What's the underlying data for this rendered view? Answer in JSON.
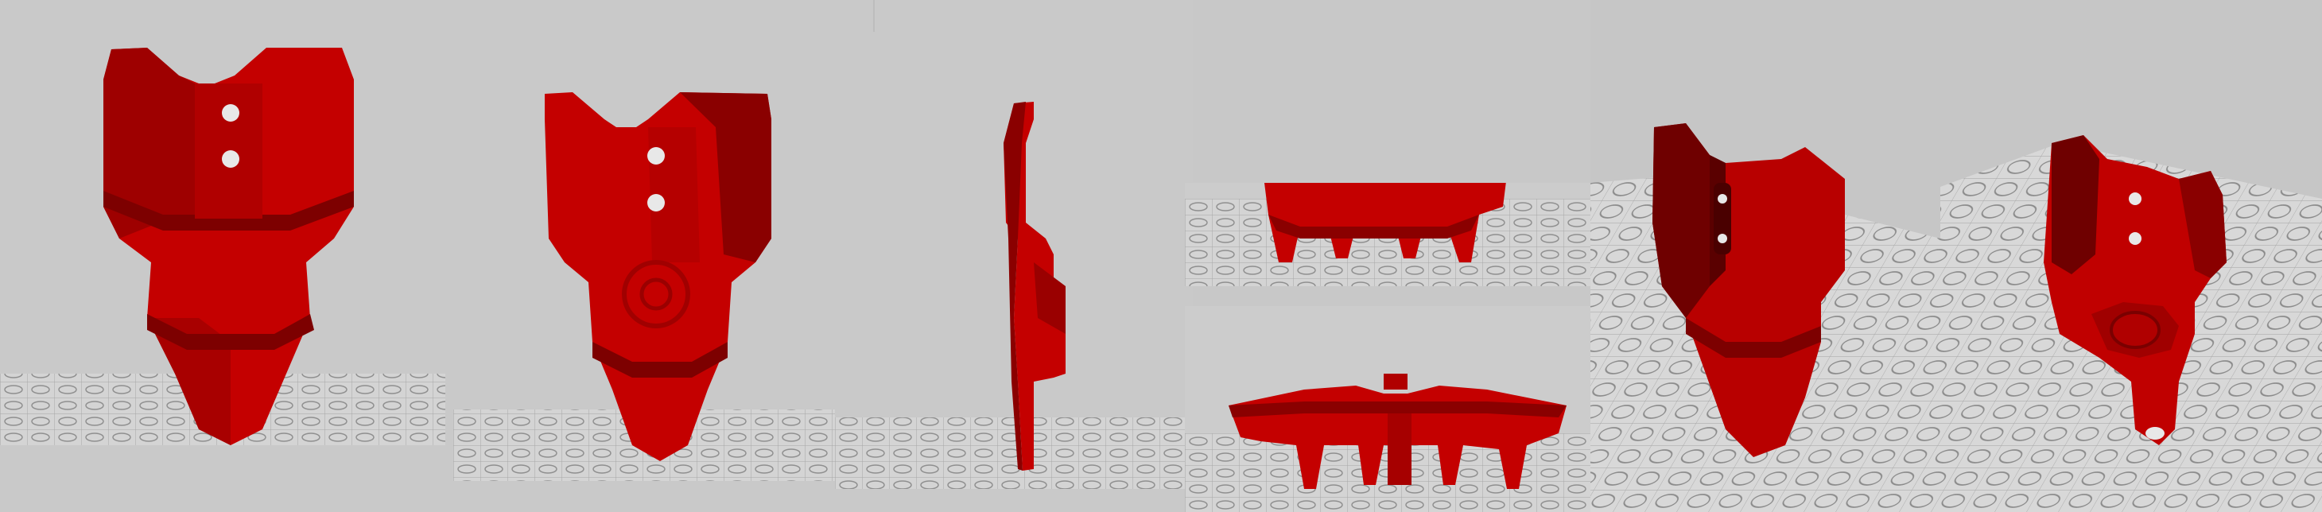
{
  "scene": {
    "part_color": "#c00000",
    "part_shadow": "#8a0000",
    "part_highlight": "#e01010",
    "background": "#c8c8c8",
    "grid_color": "#9a9a9a"
  },
  "views": [
    {
      "id": "front",
      "name": "front-view"
    },
    {
      "id": "back",
      "name": "back-view"
    },
    {
      "id": "side",
      "name": "side-view"
    },
    {
      "id": "top",
      "name": "top-view"
    },
    {
      "id": "bottom",
      "name": "bottom-view"
    },
    {
      "id": "iso-front",
      "name": "isometric-front-view"
    },
    {
      "id": "iso-back",
      "name": "isometric-back-view"
    }
  ]
}
